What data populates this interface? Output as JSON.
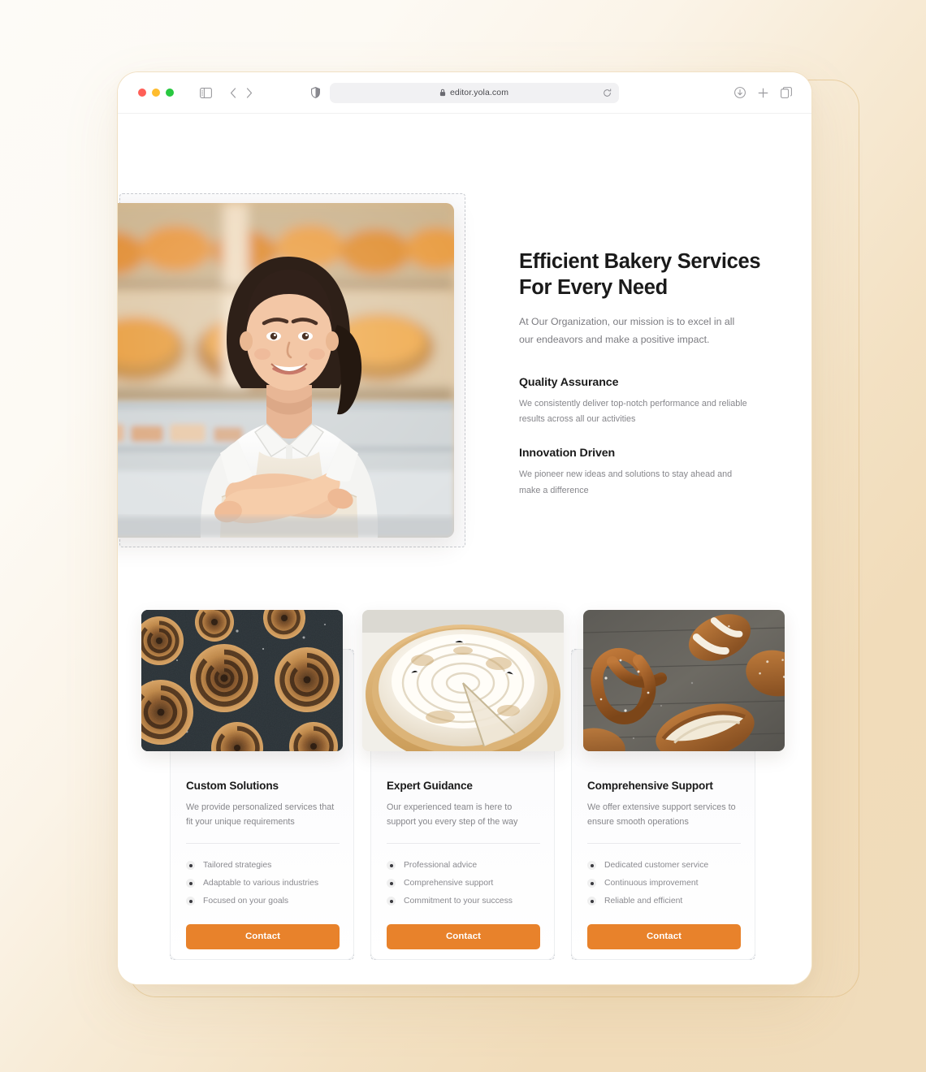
{
  "browser": {
    "url": "editor.yola.com",
    "lock_icon": "lock-icon",
    "reload_icon": "reload-icon",
    "sidebar_icon": "sidebar-toggle-icon",
    "back_icon": "chevron-left-icon",
    "forward_icon": "chevron-right-icon",
    "shield_icon": "privacy-shield-icon",
    "download_icon": "download-icon",
    "new_tab_icon": "plus-icon",
    "tabs_icon": "tab-overview-icon",
    "traffic_lights": [
      "close-red",
      "minimize-yellow",
      "zoom-green"
    ]
  },
  "hero": {
    "title": "Efficient Bakery Services For Every Need",
    "subtitle": "At Our Organization, our mission is to excel in all our endeavors and make a positive impact.",
    "image_alt": "smiling-baker-in-bakery",
    "features": [
      {
        "title": "Quality Assurance",
        "body": "We consistently deliver top-notch performance and reliable results across all our activities"
      },
      {
        "title": "Innovation Driven",
        "body": "We pioneer new ideas and solutions to stay ahead and make a difference"
      }
    ]
  },
  "cards": [
    {
      "image_alt": "cinnamon-rolls-dusted-with-sugar",
      "title": "Custom Solutions",
      "description": "We provide personalized services that fit your unique requirements",
      "items": [
        "Tailored strategies",
        "Adaptable to various industries",
        "Focused on your goals"
      ],
      "button": "Contact"
    },
    {
      "image_alt": "meringue-topped-pie",
      "title": "Expert Guidance",
      "description": "Our experienced team is here to support you every step of the way",
      "items": [
        "Professional advice",
        "Comprehensive support",
        "Commitment to your success"
      ],
      "button": "Contact"
    },
    {
      "image_alt": "pretzels-and-bread-rolls",
      "title": "Comprehensive Support",
      "description": "We offer extensive support services to ensure smooth operations",
      "items": [
        "Dedicated customer service",
        "Continuous improvement",
        "Reliable and efficient"
      ],
      "button": "Contact"
    }
  ],
  "colors": {
    "accent": "#e8822b",
    "page_background": "#f1dcba",
    "text_primary": "#1a1a1a",
    "text_muted": "#86868b",
    "selection_outline": "#c9ccd1"
  }
}
